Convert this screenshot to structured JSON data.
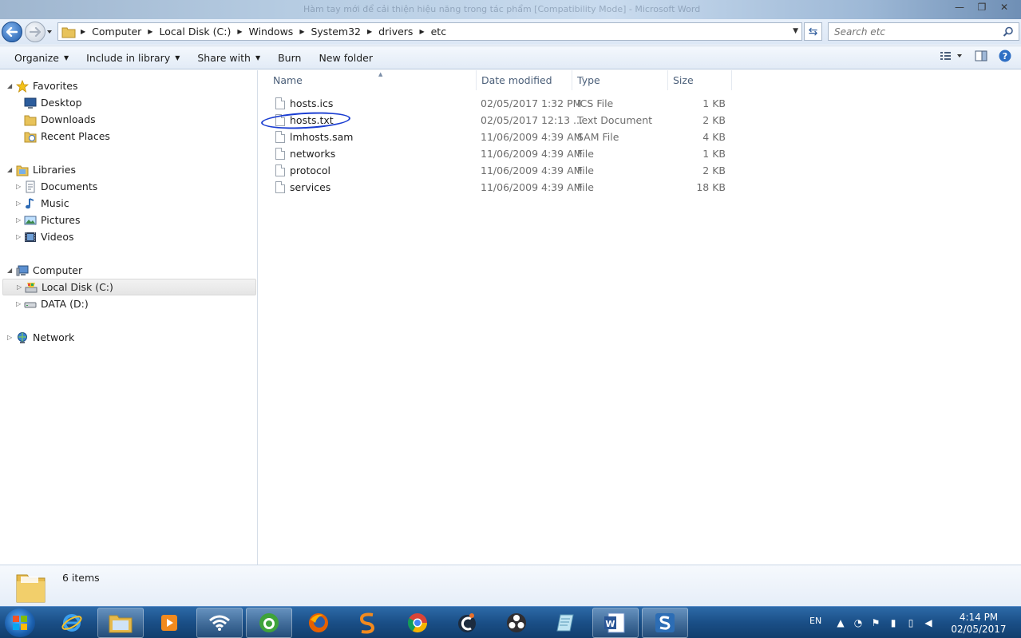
{
  "window": {
    "title": "Hàm tay mới để cải thiện hiệu năng trong tác phẩm [Compatibility Mode] - Microsoft Word",
    "controls": {
      "minimize": "—",
      "maximize": "❐",
      "close": "✕"
    }
  },
  "address": {
    "crumbs": [
      "Computer",
      "Local Disk (C:)",
      "Windows",
      "System32",
      "drivers",
      "etc"
    ],
    "search_placeholder": "Search etc"
  },
  "toolbar": {
    "organize": "Organize",
    "include_in_library": "Include in library",
    "share_with": "Share with",
    "burn": "Burn",
    "new_folder": "New folder"
  },
  "nav": {
    "favorites": "Favorites",
    "desktop": "Desktop",
    "downloads": "Downloads",
    "recent_places": "Recent Places",
    "libraries": "Libraries",
    "documents": "Documents",
    "music": "Music",
    "pictures": "Pictures",
    "videos": "Videos",
    "computer": "Computer",
    "local_disk": "Local Disk (C:)",
    "data_disk": "DATA (D:)",
    "network": "Network"
  },
  "columns": {
    "name": "Name",
    "date": "Date modified",
    "type": "Type",
    "size": "Size"
  },
  "files": [
    {
      "name": "hosts.ics",
      "date": "02/05/2017 1:32 PM",
      "type": "ICS File",
      "size": "1 KB"
    },
    {
      "name": "hosts.txt",
      "date": "02/05/2017 12:13 ...",
      "type": "Text Document",
      "size": "2 KB"
    },
    {
      "name": "lmhosts.sam",
      "date": "11/06/2009 4:39 AM",
      "type": "SAM File",
      "size": "4 KB"
    },
    {
      "name": "networks",
      "date": "11/06/2009 4:39 AM",
      "type": "File",
      "size": "1 KB"
    },
    {
      "name": "protocol",
      "date": "11/06/2009 4:39 AM",
      "type": "File",
      "size": "2 KB"
    },
    {
      "name": "services",
      "date": "11/06/2009 4:39 AM",
      "type": "File",
      "size": "18 KB"
    }
  ],
  "status": {
    "item_count": "6 items"
  },
  "taskbar": {
    "language": "EN",
    "time": "4:14 PM",
    "date": "02/05/2017"
  },
  "colors": {
    "accent": "#1a4f87",
    "annotation_circle": "#1a3dd1",
    "selection": "#e5e5e5"
  }
}
